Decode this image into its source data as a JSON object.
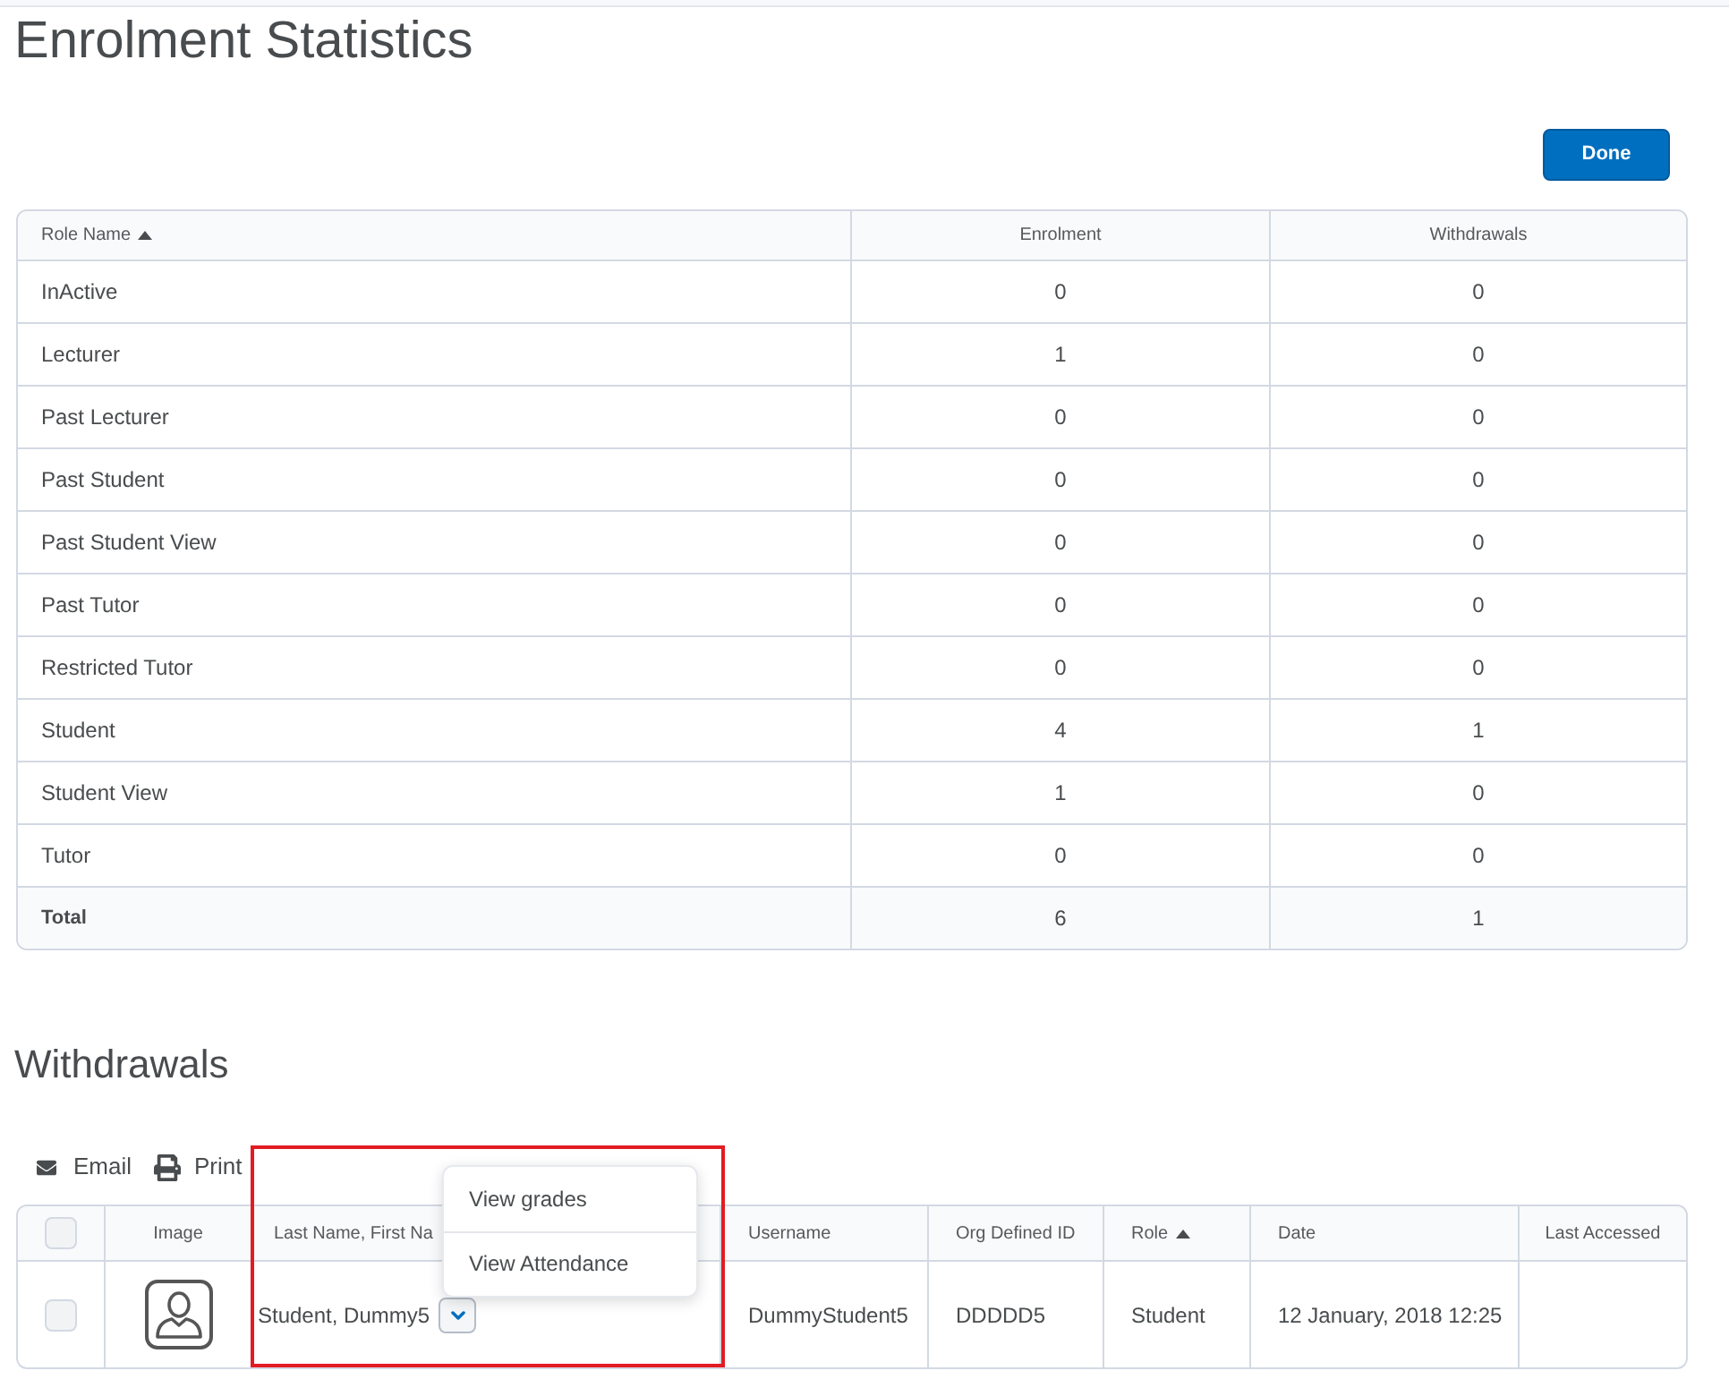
{
  "page": {
    "title": "Enrolment Statistics"
  },
  "done_button": {
    "label": "Done"
  },
  "enrolment_table": {
    "columns": [
      {
        "label": "Role Name",
        "sorted": true
      },
      {
        "label": "Enrolment",
        "sorted": false
      },
      {
        "label": "Withdrawals",
        "sorted": false
      }
    ],
    "rows": [
      {
        "role": "InActive",
        "enrolment": "0",
        "withdrawals": "0"
      },
      {
        "role": "Lecturer",
        "enrolment": "1",
        "withdrawals": "0"
      },
      {
        "role": "Past Lecturer",
        "enrolment": "0",
        "withdrawals": "0"
      },
      {
        "role": "Past Student",
        "enrolment": "0",
        "withdrawals": "0"
      },
      {
        "role": "Past Student View",
        "enrolment": "0",
        "withdrawals": "0"
      },
      {
        "role": "Past Tutor",
        "enrolment": "0",
        "withdrawals": "0"
      },
      {
        "role": "Restricted Tutor",
        "enrolment": "0",
        "withdrawals": "0"
      },
      {
        "role": "Student",
        "enrolment": "4",
        "withdrawals": "1"
      },
      {
        "role": "Student View",
        "enrolment": "1",
        "withdrawals": "0"
      },
      {
        "role": "Tutor",
        "enrolment": "0",
        "withdrawals": "0"
      }
    ],
    "total": {
      "label": "Total",
      "enrolment": "6",
      "withdrawals": "1"
    }
  },
  "withdrawals": {
    "heading": "Withdrawals",
    "toolbar": [
      {
        "kind": "email",
        "label": "Email"
      },
      {
        "kind": "print",
        "label": "Print"
      }
    ],
    "columns": [
      {
        "kind": "checkbox",
        "checked": false
      },
      {
        "kind": "text",
        "label": "Image",
        "sorted": false
      },
      {
        "kind": "text",
        "label": "Last Name, First Na",
        "sorted": false
      },
      {
        "kind": "text",
        "label": "Username",
        "sorted": false
      },
      {
        "kind": "text",
        "label": "Org Defined ID",
        "sorted": false
      },
      {
        "kind": "text",
        "label": "Role",
        "sorted": true
      },
      {
        "kind": "text",
        "label": "Date",
        "sorted": false
      },
      {
        "kind": "text",
        "label": "Last Accessed",
        "sorted": false
      }
    ],
    "rows": [
      {
        "checked": false,
        "name": "Student, Dummy5",
        "menu_open": true,
        "username": "DummyStudent5",
        "org_defined_id": "DDDDD5",
        "role": "Student",
        "date": "12 January, 2018 12:25"
      }
    ],
    "row_menu": [
      {
        "label": "View grades"
      },
      {
        "label": "View Attendance"
      }
    ],
    "highlight": {
      "kind": "rectangle"
    }
  }
}
